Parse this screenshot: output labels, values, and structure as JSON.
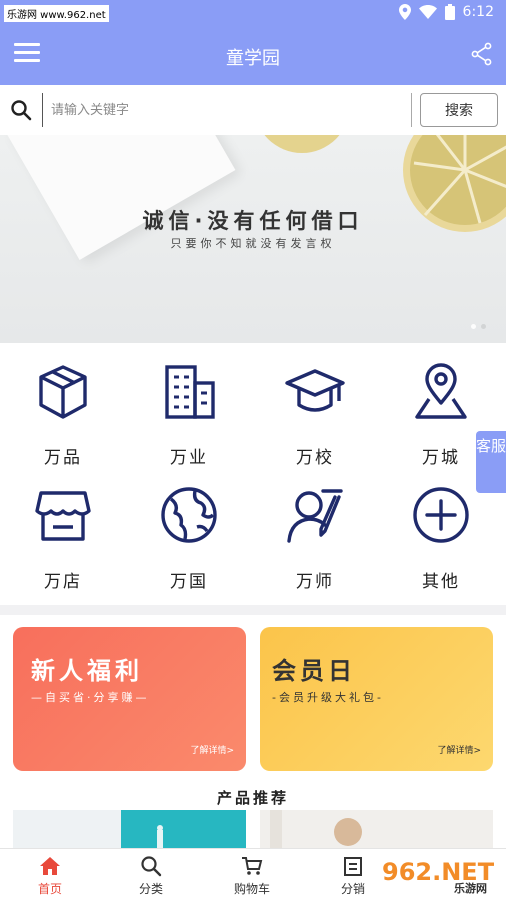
{
  "status": {
    "site_tag": "乐游网 www.962.net",
    "time": "6:12"
  },
  "header": {
    "title": "童学园"
  },
  "search": {
    "placeholder": "请输入关键字",
    "button": "搜索"
  },
  "banner": {
    "headline": "诚信·没有任何借口",
    "subline": "只要你不知就没有发言权",
    "slide_count": 2,
    "active_slide": 0
  },
  "categories": [
    {
      "label": "万品",
      "icon": "box-icon"
    },
    {
      "label": "万业",
      "icon": "building-icon"
    },
    {
      "label": "万校",
      "icon": "graduation-cap-icon"
    },
    {
      "label": "万城",
      "icon": "map-pin-icon"
    },
    {
      "label": "万店",
      "icon": "store-icon"
    },
    {
      "label": "万国",
      "icon": "globe-icon"
    },
    {
      "label": "万师",
      "icon": "teacher-icon"
    },
    {
      "label": "其他",
      "icon": "plus-circle-icon"
    }
  ],
  "service_tab": {
    "label": "客服"
  },
  "promos": [
    {
      "title": "新人福利",
      "subtitle": "—自买省·分享赚—",
      "more": "了解详情>"
    },
    {
      "title": "会员日",
      "subtitle": "-会员升级大礼包-",
      "more": "了解详情>"
    }
  ],
  "products": {
    "title": "产品推荐"
  },
  "nav": {
    "items": [
      {
        "label": "首页",
        "icon": "home-icon",
        "active": true
      },
      {
        "label": "分类",
        "icon": "search-icon",
        "active": false
      },
      {
        "label": "购物车",
        "icon": "cart-icon",
        "active": false
      },
      {
        "label": "分销",
        "icon": "distribution-icon",
        "active": false
      }
    ]
  },
  "watermark": {
    "text": "962.NET",
    "sub": "乐游网"
  },
  "colors": {
    "primary": "#8a9df6",
    "icon": "#1f2a6b",
    "promo_red": "#f86f5c",
    "promo_yellow": "#fbc44a",
    "nav_active": "#e8493b"
  }
}
